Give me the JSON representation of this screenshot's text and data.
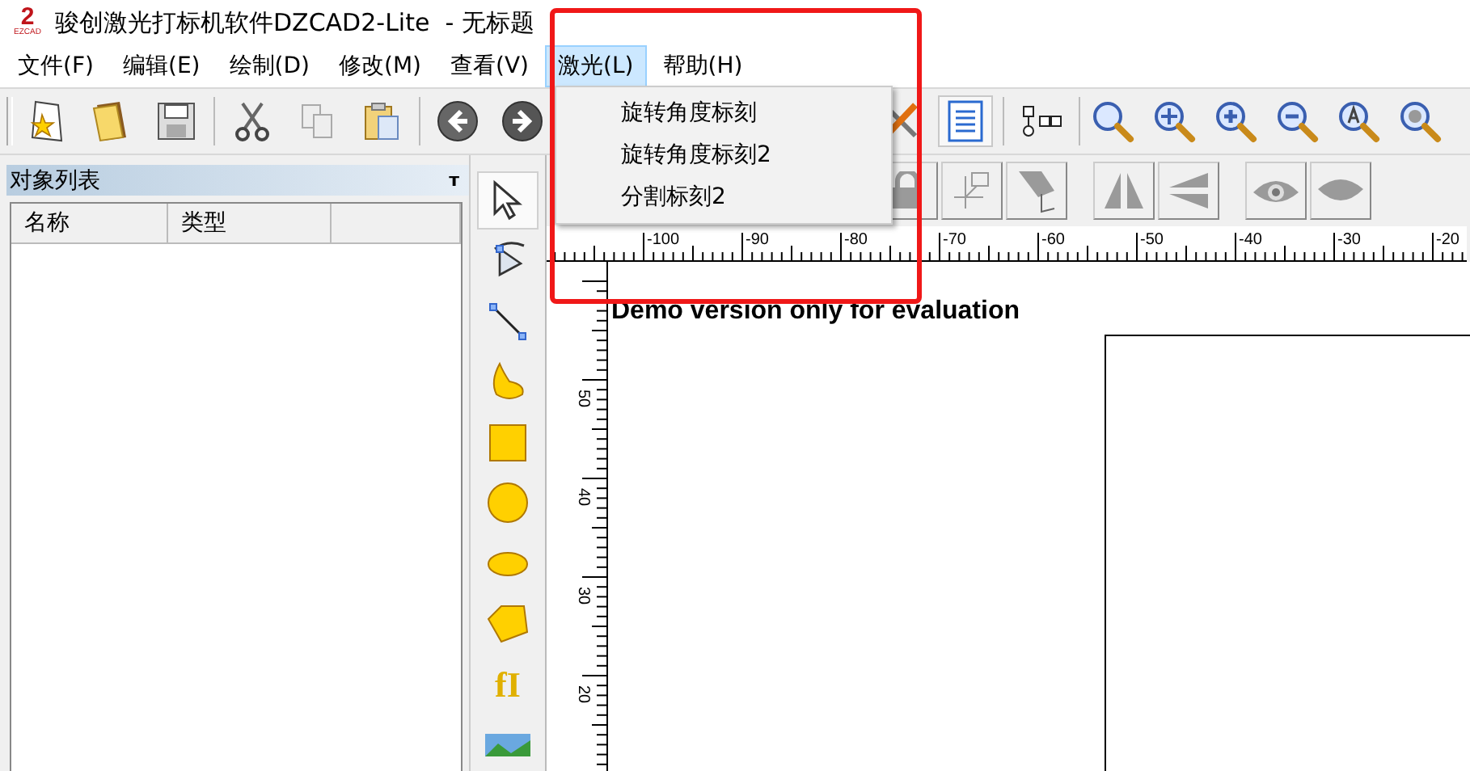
{
  "window": {
    "title": "骏创激光打标机软件DZCAD2-Lite  - 无标题",
    "logo_number": "2",
    "logo_caption": "EZCAD"
  },
  "menu": [
    {
      "label": "文件(F)",
      "selected": false
    },
    {
      "label": "编辑(E)",
      "selected": false
    },
    {
      "label": "绘制(D)",
      "selected": false
    },
    {
      "label": "修改(M)",
      "selected": false
    },
    {
      "label": "查看(V)",
      "selected": false
    },
    {
      "label": "激光(L)",
      "selected": true
    },
    {
      "label": "帮助(H)",
      "selected": false
    }
  ],
  "dropdown": {
    "items": [
      "旋转角度标刻",
      "旋转角度标刻2",
      "分割标刻2"
    ]
  },
  "object_list": {
    "title": "对象列表",
    "pin": "т",
    "columns": [
      "名称",
      "类型",
      ""
    ]
  },
  "tools": [
    {
      "kind": "pointer",
      "selected": true
    },
    {
      "kind": "node",
      "selected": false
    },
    {
      "kind": "line",
      "selected": false
    },
    {
      "kind": "curve",
      "selected": false
    },
    {
      "kind": "rect",
      "selected": false
    },
    {
      "kind": "circle",
      "selected": false
    },
    {
      "kind": "ellipse",
      "selected": false
    },
    {
      "kind": "polygon",
      "selected": false
    },
    {
      "kind": "text",
      "selected": false
    },
    {
      "kind": "image",
      "selected": false
    }
  ],
  "text_tool_label": "fI",
  "ruler": {
    "x_labels": [
      "-100",
      "-90",
      "-80",
      "-70",
      "-60",
      "-50",
      "-40",
      "-30",
      "-20"
    ],
    "y_labels": [
      "50",
      "40",
      "30",
      "20"
    ]
  },
  "canvas": {
    "watermark": "Demo version only for evaluation"
  }
}
